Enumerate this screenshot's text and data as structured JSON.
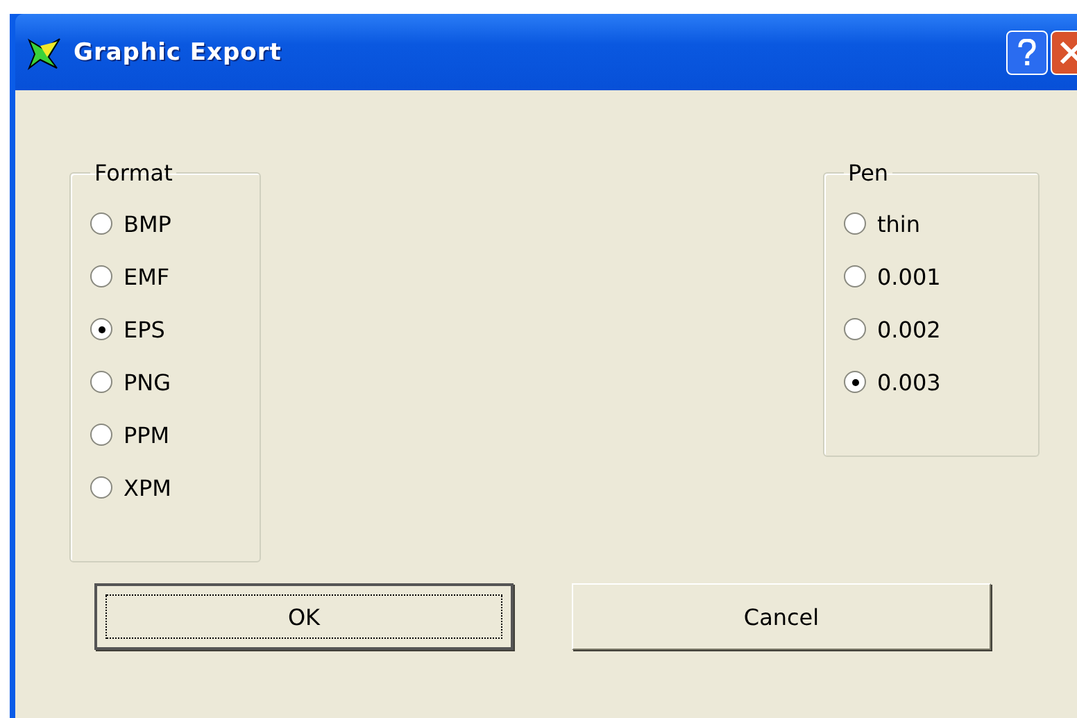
{
  "window": {
    "title": "Graphic Export"
  },
  "groups": [
    {
      "label": "Format",
      "options": [
        {
          "label": "BMP",
          "selected": false
        },
        {
          "label": "EMF",
          "selected": false
        },
        {
          "label": "EPS",
          "selected": true
        },
        {
          "label": "PNG",
          "selected": false
        },
        {
          "label": "PPM",
          "selected": false
        },
        {
          "label": "XPM",
          "selected": false
        }
      ]
    },
    {
      "label": "Pen",
      "options": [
        {
          "label": "thin",
          "selected": false
        },
        {
          "label": "0.001",
          "selected": false
        },
        {
          "label": "0.002",
          "selected": false
        },
        {
          "label": "0.003",
          "selected": true
        }
      ]
    }
  ],
  "buttons": [
    {
      "label": "OK",
      "focused": true
    },
    {
      "label": "Cancel",
      "focused": false
    }
  ]
}
